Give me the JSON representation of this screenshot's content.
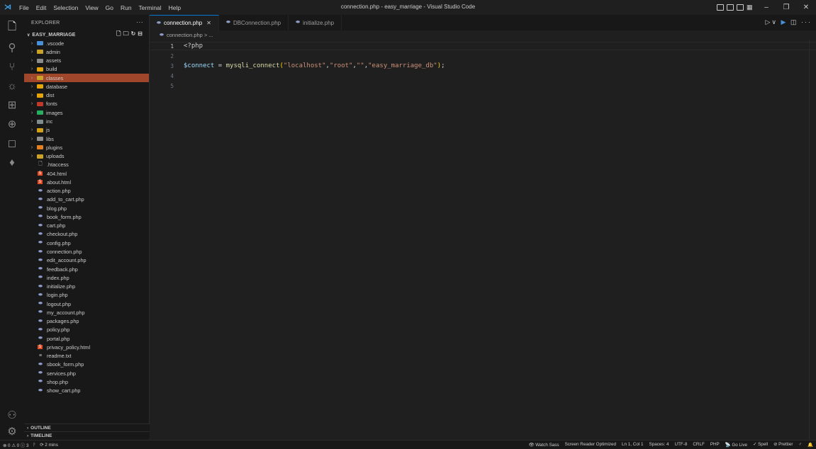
{
  "titlebar": {
    "menu": [
      "File",
      "Edit",
      "Selection",
      "View",
      "Go",
      "Run",
      "Terminal",
      "Help"
    ],
    "window_title": "connection.php - easy_marriage - Visual Studio Code"
  },
  "sidebar": {
    "title": "EXPLORER",
    "root": "EASY_MARRIAGE",
    "folders": [
      {
        "name": ".vscode",
        "color": "#4a90d9"
      },
      {
        "name": "admin",
        "color": "#c9a227"
      },
      {
        "name": "assets",
        "color": "#8b8b8b"
      },
      {
        "name": "build",
        "color": "#e5a50a"
      },
      {
        "name": "classes",
        "color": "#c9a227"
      },
      {
        "name": "database",
        "color": "#e5a50a"
      },
      {
        "name": "dist",
        "color": "#e5a50a"
      },
      {
        "name": "fonts",
        "color": "#c0392b"
      },
      {
        "name": "images",
        "color": "#27ae60"
      },
      {
        "name": "inc",
        "color": "#7f8c8d"
      },
      {
        "name": "js",
        "color": "#d4a017"
      },
      {
        "name": "libs",
        "color": "#8e8e8e"
      },
      {
        "name": "plugins",
        "color": "#e67e22"
      },
      {
        "name": "uploads",
        "color": "#c9a227"
      }
    ],
    "files": [
      {
        "name": ".htaccess",
        "icon": "document-icon",
        "color": "#cccccc"
      },
      {
        "name": "404.html",
        "icon": "html5-icon",
        "color": "#e44d26"
      },
      {
        "name": "about.html",
        "icon": "html5-icon",
        "color": "#e44d26"
      },
      {
        "name": "action.php",
        "icon": "php-icon",
        "color": "#8c9cc7"
      },
      {
        "name": "add_to_cart.php",
        "icon": "php-icon",
        "color": "#8c9cc7"
      },
      {
        "name": "blog.php",
        "icon": "php-icon",
        "color": "#8c9cc7"
      },
      {
        "name": "book_form.php",
        "icon": "php-icon",
        "color": "#8c9cc7"
      },
      {
        "name": "cart.php",
        "icon": "php-icon",
        "color": "#8c9cc7"
      },
      {
        "name": "checkout.php",
        "icon": "php-icon",
        "color": "#8c9cc7"
      },
      {
        "name": "config.php",
        "icon": "php-icon",
        "color": "#8c9cc7"
      },
      {
        "name": "connection.php",
        "icon": "php-icon",
        "color": "#8c9cc7"
      },
      {
        "name": "edit_account.php",
        "icon": "php-icon",
        "color": "#8c9cc7"
      },
      {
        "name": "feedback.php",
        "icon": "php-icon",
        "color": "#8c9cc7"
      },
      {
        "name": "index.php",
        "icon": "php-icon",
        "color": "#8c9cc7"
      },
      {
        "name": "initialize.php",
        "icon": "php-icon",
        "color": "#8c9cc7"
      },
      {
        "name": "login.php",
        "icon": "php-icon",
        "color": "#8c9cc7"
      },
      {
        "name": "logout.php",
        "icon": "php-icon",
        "color": "#8c9cc7"
      },
      {
        "name": "my_account.php",
        "icon": "php-icon",
        "color": "#8c9cc7"
      },
      {
        "name": "packages.php",
        "icon": "php-icon",
        "color": "#8c9cc7"
      },
      {
        "name": "policy.php",
        "icon": "php-icon",
        "color": "#8c9cc7"
      },
      {
        "name": "portal.php",
        "icon": "php-icon",
        "color": "#8c9cc7"
      },
      {
        "name": "privacy_policy.html",
        "icon": "html5-icon",
        "color": "#e44d26"
      },
      {
        "name": "readme.txt",
        "icon": "text-file-icon",
        "color": "#cccccc"
      },
      {
        "name": "sbook_form.php",
        "icon": "php-icon",
        "color": "#8c9cc7"
      },
      {
        "name": "services.php",
        "icon": "php-icon",
        "color": "#8c9cc7"
      },
      {
        "name": "shop.php",
        "icon": "php-icon",
        "color": "#8c9cc7"
      },
      {
        "name": "show_cart.php",
        "icon": "php-icon",
        "color": "#8c9cc7"
      }
    ],
    "selected": "classes",
    "outline": "OUTLINE",
    "timeline": "TIMELINE"
  },
  "tabs": [
    {
      "label": "connection.php",
      "active": true
    },
    {
      "label": "DBConnection.php",
      "active": false
    },
    {
      "label": "initialize.php",
      "active": false
    }
  ],
  "breadcrumb": "connection.php > ...",
  "code": {
    "line_numbers": [
      "1",
      "2",
      "3",
      "4",
      "5"
    ],
    "line1": "<?php",
    "var": "$connect",
    "eq": " = ",
    "fn": "mysqli_connect",
    "open": "(",
    "arg1": "\"localhost\"",
    "arg2": "\"root\"",
    "arg3": "\"\"",
    "arg4": "\"easy_marriage_db\"",
    "comma": ",",
    "close": ")",
    "semi": ";"
  },
  "statusbar": {
    "problems": "⊗ 0 ⚠ 0 ⓘ 3",
    "branch_icon": "ᚹ",
    "time": "⟳ 2 mins",
    "right": [
      "👁 Watch Sass",
      "Screen Reader Optimized",
      "Ln 1, Col 1",
      "Spaces: 4",
      "UTF-8",
      "CRLF",
      "PHP",
      "📡 Go Live",
      "✓ Spell",
      "⊘ Prettier",
      "♂",
      "🔔"
    ]
  }
}
